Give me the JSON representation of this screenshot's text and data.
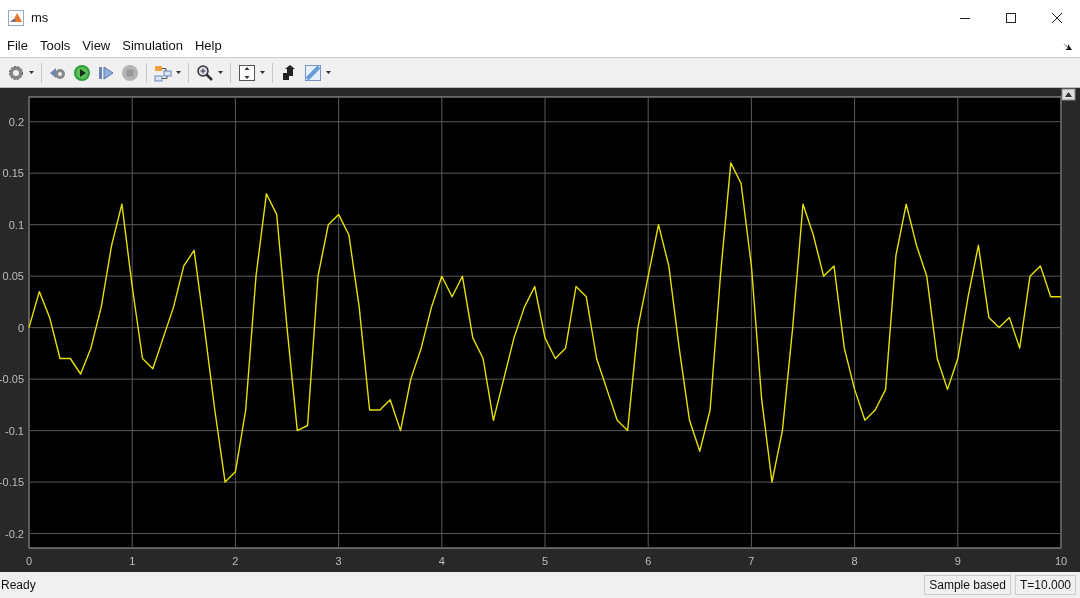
{
  "window": {
    "title": "ms"
  },
  "menu": [
    {
      "label": "File"
    },
    {
      "label": "Tools"
    },
    {
      "label": "View"
    },
    {
      "label": "Simulation"
    },
    {
      "label": "Help"
    }
  ],
  "toolbar": [
    {
      "kind": "settings",
      "dropdown": true
    },
    {
      "kind": "separator"
    },
    {
      "kind": "step_back",
      "dropdown": false
    },
    {
      "kind": "run",
      "dropdown": false
    },
    {
      "kind": "step_forward",
      "dropdown": false
    },
    {
      "kind": "stop",
      "dropdown": false
    },
    {
      "kind": "separator"
    },
    {
      "kind": "library",
      "dropdown": true
    },
    {
      "kind": "separator"
    },
    {
      "kind": "zoom",
      "dropdown": true
    },
    {
      "kind": "separator"
    },
    {
      "kind": "fit",
      "dropdown": true
    },
    {
      "kind": "separator"
    },
    {
      "kind": "highlight",
      "dropdown": false
    },
    {
      "kind": "properties",
      "dropdown": true
    }
  ],
  "scope": {
    "chart_data": {
      "type": "line",
      "grid": true,
      "xlim": [
        0,
        10
      ],
      "ylim": [
        -0.214,
        0.224
      ],
      "xticks": [
        0,
        1,
        2,
        3,
        4,
        5,
        6,
        7,
        8,
        9,
        10
      ],
      "yticks": [
        {
          "value": 0.2,
          "label": "0.2"
        },
        {
          "value": 0.15,
          "label": "0.15"
        },
        {
          "value": 0.1,
          "label": "0.1"
        },
        {
          "value": 0.05,
          "label": "0.05"
        },
        {
          "value": 0,
          "label": "0"
        },
        {
          "value": -0.05,
          "label": "-0.05"
        },
        {
          "value": -0.1,
          "label": "-0.1"
        },
        {
          "value": -0.15,
          "label": "-0.15"
        },
        {
          "value": -0.2,
          "label": "-0.2"
        }
      ],
      "x": [
        0,
        0.1,
        0.2,
        0.3,
        0.4,
        0.5,
        0.6,
        0.7,
        0.8,
        0.9,
        1,
        1.1,
        1.2,
        1.3,
        1.4,
        1.5,
        1.6,
        1.7,
        1.8,
        1.9,
        2,
        2.1,
        2.2,
        2.3,
        2.4,
        2.5,
        2.6,
        2.7,
        2.8,
        2.9,
        3,
        3.1,
        3.2,
        3.3,
        3.4,
        3.5,
        3.6,
        3.7,
        3.8,
        3.9,
        4,
        4.1,
        4.2,
        4.3,
        4.4,
        4.5,
        4.6,
        4.7,
        4.8,
        4.9,
        5,
        5.1,
        5.2,
        5.3,
        5.4,
        5.5,
        5.6,
        5.7,
        5.8,
        5.9,
        6,
        6.1,
        6.2,
        6.3,
        6.4,
        6.5,
        6.6,
        6.7,
        6.8,
        6.9,
        7,
        7.1,
        7.2,
        7.3,
        7.4,
        7.5,
        7.6,
        7.7,
        7.8,
        7.9,
        8,
        8.1,
        8.2,
        8.3,
        8.4,
        8.5,
        8.6,
        8.7,
        8.8,
        8.9,
        9,
        9.1,
        9.2,
        9.3,
        9.4,
        9.5,
        9.6,
        9.7,
        9.8,
        9.9,
        10
      ],
      "values": [
        0,
        0.035,
        0.01,
        -0.03,
        -0.03,
        -0.045,
        -0.02,
        0.02,
        0.08,
        0.12,
        0.04,
        -0.03,
        -0.04,
        -0.01,
        0.02,
        0.06,
        0.075,
        0,
        -0.08,
        -0.15,
        -0.14,
        -0.08,
        0.05,
        0.13,
        0.11,
        0,
        -0.1,
        -0.095,
        0.05,
        0.1,
        0.11,
        0.09,
        0.02,
        -0.08,
        -0.08,
        -0.07,
        -0.1,
        -0.05,
        -0.02,
        0.02,
        0.05,
        0.03,
        0.05,
        -0.01,
        -0.03,
        -0.09,
        -0.05,
        -0.01,
        0.02,
        0.04,
        -0.01,
        -0.03,
        -0.02,
        0.04,
        0.03,
        -0.03,
        -0.06,
        -0.09,
        -0.1,
        0,
        0.05,
        0.1,
        0.06,
        -0.02,
        -0.09,
        -0.12,
        -0.08,
        0.05,
        0.16,
        0.14,
        0.06,
        -0.07,
        -0.15,
        -0.1,
        0,
        0.12,
        0.09,
        0.05,
        0.06,
        -0.02,
        -0.06,
        -0.09,
        -0.08,
        -0.06,
        0.07,
        0.12,
        0.08,
        0.05,
        -0.03,
        -0.06,
        -0.03,
        0.03,
        0.08,
        0.01,
        0,
        0.01,
        -0.02,
        0.05,
        0.06,
        0.03,
        0.03
      ]
    }
  },
  "status_bar": {
    "message": "Ready",
    "sections": [
      "Sample based",
      "T=10.000"
    ]
  }
}
